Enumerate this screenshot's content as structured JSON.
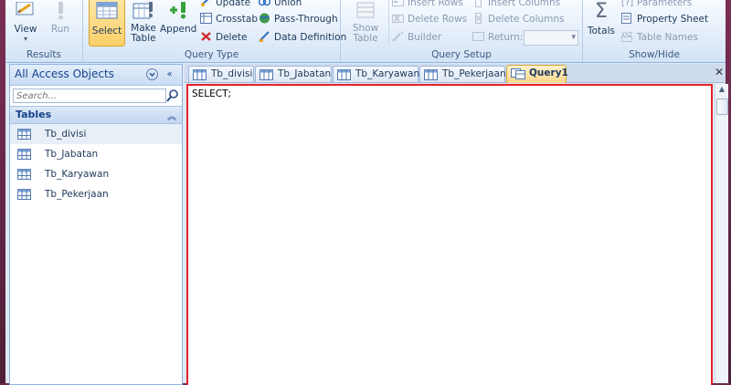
{
  "ribbon": {
    "results": {
      "label": "Results",
      "view_label": "View",
      "run_label": "Run"
    },
    "query_type": {
      "label": "Query Type",
      "select_label": "Select",
      "make_table_label": "Make\nTable",
      "append_label": "Append",
      "update_label": "Update",
      "crosstab_label": "Crosstab",
      "delete_label": "Delete",
      "union_label": "Union",
      "pass_through_label": "Pass-Through",
      "data_definition_label": "Data Definition"
    },
    "query_setup": {
      "label": "Query Setup",
      "show_table_label": "Show\nTable",
      "insert_rows_label": "Insert Rows",
      "delete_rows_label": "Delete Rows",
      "builder_label": "Builder",
      "insert_columns_label": "Insert Columns",
      "delete_columns_label": "Delete Columns",
      "return_label": "Return:",
      "return_value": ""
    },
    "show_hide": {
      "label": "Show/Hide",
      "totals_label": "Totals",
      "parameters_label": "Parameters",
      "property_sheet_label": "Property Sheet",
      "table_names_label": "Table Names"
    }
  },
  "nav": {
    "title": "All Access Objects",
    "search_placeholder": "Search...",
    "section": "Tables",
    "items": [
      "Tb_divisi",
      "Tb_Jabatan",
      "Tb_Karyawan",
      "Tb_Pekerjaan"
    ]
  },
  "tabs": [
    "Tb_divisi",
    "Tb_Jabatan",
    "Tb_Karyawan",
    "Tb_Pekerjaan",
    "Query1"
  ],
  "active_tab": "Query1",
  "editor": {
    "sql": "SELECT;"
  },
  "colors": {
    "editor_border": "#e8202a",
    "selected_button": "#fbd06a",
    "active_tab": "#fbd689"
  }
}
